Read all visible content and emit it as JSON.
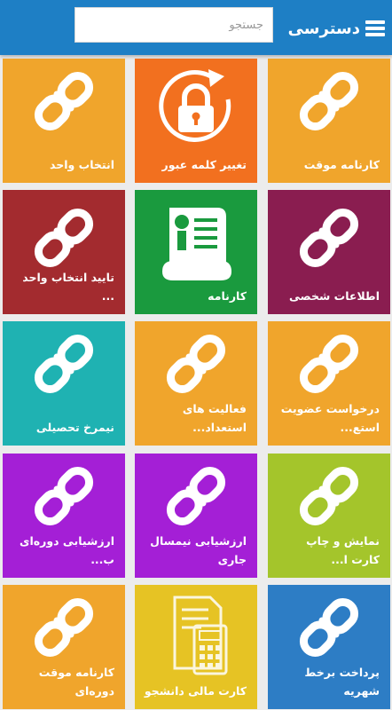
{
  "header": {
    "title": "دسترسی",
    "search_placeholder": "جستجو"
  },
  "tiles": [
    {
      "label": "کارنامه موقت",
      "color": "#f0a52c",
      "icon": "link-icon"
    },
    {
      "label": "تغییر کلمه عبور",
      "color": "#f2701f",
      "icon": "lock-refresh-icon"
    },
    {
      "label": "انتخاب واحد",
      "color": "#f0a52c",
      "icon": "link-icon"
    },
    {
      "label": "اطلاعات شخصی",
      "color": "#8a1d50",
      "icon": "link-icon"
    },
    {
      "label": "کارنامه",
      "color": "#1a9a3e",
      "icon": "certificate-scroll-icon"
    },
    {
      "label": "تایید انتخاب واحد ...",
      "color": "#a32b2f",
      "icon": "link-icon"
    },
    {
      "label": "درخواست عضویت استع...",
      "color": "#f0a52c",
      "icon": "link-icon"
    },
    {
      "label": "فعالیت های استعداد...",
      "color": "#f0a52c",
      "icon": "link-icon"
    },
    {
      "label": "نیمرخ تحصیلی",
      "color": "#1fb2b2",
      "icon": "link-icon"
    },
    {
      "label": "نمایش و چاپ کارت ا...",
      "color": "#a4c52b",
      "icon": "link-icon"
    },
    {
      "label": "ارزشیابی نیمسال جاری",
      "color": "#a41fd6",
      "icon": "link-icon"
    },
    {
      "label": "ارزشیابی دوره‌ای ب...",
      "color": "#a41fd6",
      "icon": "link-icon"
    },
    {
      "label": "پرداخت برخط شهریه",
      "color": "#2d7dc5",
      "icon": "link-icon"
    },
    {
      "label": "کارت مالی دانشجو",
      "color": "#e6c324",
      "icon": "invoice-calculator-icon"
    },
    {
      "label": "کارنامه موقت دوره‌ای",
      "color": "#f0a52c",
      "icon": "link-icon"
    }
  ]
}
